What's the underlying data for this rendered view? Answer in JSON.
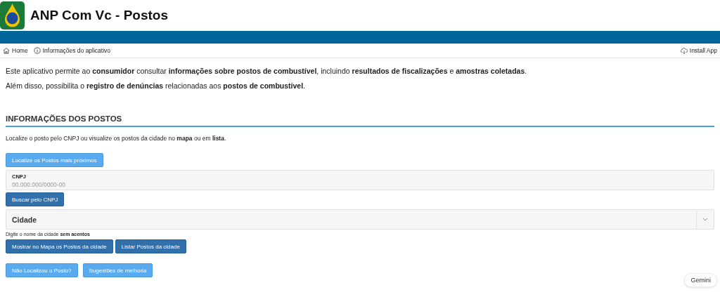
{
  "header": {
    "title": "ANP Com Vc - Postos"
  },
  "nav": {
    "items": [
      {
        "label": "Home",
        "kind": "home"
      },
      {
        "label": "Informações do aplicativo",
        "kind": "info"
      }
    ],
    "install": "Install App"
  },
  "intro": [
    "Este aplicativo permite ao **consumidor** consultar **informações sobre postos de combustível**, incluindo **resultados de fiscalizações** e **amostras coletadas**.",
    "Além disso, possibilita o **registro de denúncias** relacionadas aos **postos de combustível**."
  ],
  "section": {
    "title": "INFORMAÇÕES DOS POSTOS",
    "description": "Localize o posto pelo CNPJ ou visualize os postos da cidade no **mapa** ou em **lista**."
  },
  "nearest_button": {
    "label": "Localize os Postos mais próximos",
    "kind": "light"
  },
  "cnpj": {
    "label": "CNPJ",
    "placeholder": "00.000.000/0000-00"
  },
  "search_button": {
    "label": "Buscar pelo CNPJ",
    "kind": "dark"
  },
  "city": {
    "placeholder": "Cidade",
    "hint": "Digite o nome da cidade **sem acentos**"
  },
  "city_buttons": [
    {
      "label": "Mostrar no Mapa os Postos da cidade",
      "kind": "dark"
    },
    {
      "label": "Listar Postos da cidade",
      "kind": "dark"
    }
  ],
  "bottom_buttons": [
    {
      "label": "Não Localizou o Posto?",
      "kind": "light"
    },
    {
      "label": "Sugestões de melhoria",
      "kind": "light"
    }
  ],
  "assistant_button": "Gemini"
}
